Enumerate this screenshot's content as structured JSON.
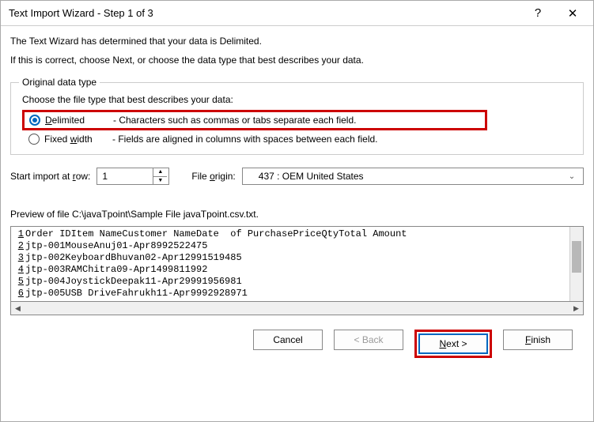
{
  "window": {
    "title": "Text Import Wizard - Step 1 of 3",
    "help": "?",
    "close": "✕"
  },
  "intro1": "The Text Wizard has determined that your data is Delimited.",
  "intro2": "If this is correct, choose Next, or choose the data type that best describes your data.",
  "group": {
    "legend": "Original data type",
    "choose": "Choose the file type that best describes your data:",
    "delimited_label": "Delimited",
    "delimited_desc": "- Characters such as commas or tabs separate each field.",
    "fixed_label": "Fixed width",
    "fixed_desc": "- Fields are aligned in columns with spaces between each field."
  },
  "params": {
    "start_label_pre": "Start import at ",
    "start_label_ul": "r",
    "start_label_post": "ow:",
    "start_value": "1",
    "origin_label_pre": "File ",
    "origin_label_ul": "o",
    "origin_label_post": "rigin:",
    "origin_value": "437 : OEM United States"
  },
  "preview": {
    "label": "Preview of file C:\\javaTpoint\\Sample File javaTpoint.csv.txt.",
    "lines": [
      "Order IDItem NameCustomer NameDate  of PurchasePriceQtyTotal Amount",
      "jtp-001MouseAnuj01-Apr8992522475",
      "jtp-002KeyboardBhuvan02-Apr12991519485",
      "jtp-003RAMChitra09-Apr1499811992",
      "jtp-004JoystickDeepak11-Apr29991956981",
      "jtp-005USB DriveFahrukh11-Apr9992928971"
    ],
    "line_nums": [
      "1",
      "2",
      "3",
      "4",
      "5",
      "6"
    ]
  },
  "buttons": {
    "cancel": "Cancel",
    "back": "< Back",
    "next": "Next >",
    "finish": "Finish"
  }
}
